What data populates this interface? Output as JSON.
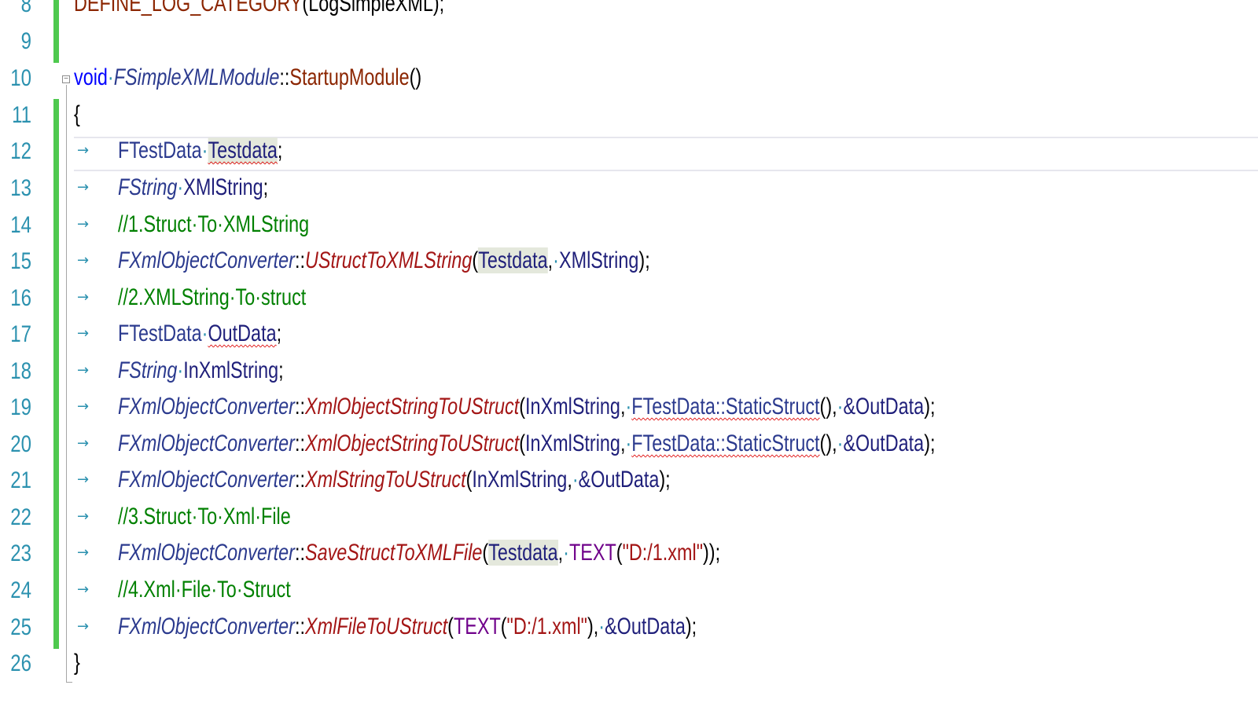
{
  "editor": {
    "lines": [
      {
        "num": "8",
        "tokens": [
          {
            "t": "DEFINE_LOG_CATEGORY",
            "c": "fn"
          },
          {
            "t": "(LogSimpleXML);",
            "c": "plain"
          }
        ]
      },
      {
        "num": "9",
        "tokens": []
      },
      {
        "num": "10",
        "tokens": [
          {
            "t": "void",
            "c": "kw"
          },
          {
            "t": "·",
            "c": "dot"
          },
          {
            "t": "FSimpleXMLModule",
            "c": "itype"
          },
          {
            "t": "::",
            "c": "plain"
          },
          {
            "t": "StartupModule",
            "c": "fn"
          },
          {
            "t": "()",
            "c": "plain"
          }
        ]
      },
      {
        "num": "11",
        "tokens": [
          {
            "t": "{",
            "c": "plain"
          }
        ]
      },
      {
        "num": "12",
        "tokens": [
          {
            "t": "FTestData",
            "c": "type"
          },
          {
            "t": "·",
            "c": "dot"
          },
          {
            "t": "Testdata",
            "c": "var hl squig"
          },
          {
            "t": ";",
            "c": "plain"
          }
        ]
      },
      {
        "num": "13",
        "tokens": [
          {
            "t": "FString",
            "c": "itype"
          },
          {
            "t": "·",
            "c": "dot"
          },
          {
            "t": "XMlString",
            "c": "var"
          },
          {
            "t": ";",
            "c": "plain"
          }
        ]
      },
      {
        "num": "14",
        "tokens": [
          {
            "t": "//1.Struct·To·XMLString",
            "c": "comment"
          }
        ]
      },
      {
        "num": "15",
        "tokens": [
          {
            "t": "FXmlObjectConverter",
            "c": "itype"
          },
          {
            "t": "::",
            "c": "plain"
          },
          {
            "t": "UStructToXMLString",
            "c": "ifn"
          },
          {
            "t": "(",
            "c": "plain"
          },
          {
            "t": "Testdata",
            "c": "var hl"
          },
          {
            "t": ",",
            "c": "plain"
          },
          {
            "t": "·",
            "c": "dot"
          },
          {
            "t": "XMlString",
            "c": "var"
          },
          {
            "t": ");",
            "c": "plain"
          }
        ]
      },
      {
        "num": "16",
        "tokens": [
          {
            "t": "//2.XMLString·To·struct",
            "c": "comment"
          }
        ]
      },
      {
        "num": "17",
        "tokens": [
          {
            "t": "FTestData",
            "c": "type"
          },
          {
            "t": "·",
            "c": "dot"
          },
          {
            "t": "OutData",
            "c": "var squig"
          },
          {
            "t": ";",
            "c": "plain"
          }
        ]
      },
      {
        "num": "18",
        "tokens": [
          {
            "t": "FString",
            "c": "itype"
          },
          {
            "t": "·",
            "c": "dot"
          },
          {
            "t": "InXmlString",
            "c": "var"
          },
          {
            "t": ";",
            "c": "plain"
          }
        ]
      },
      {
        "num": "19",
        "tokens": [
          {
            "t": "FXmlObjectConverter",
            "c": "itype"
          },
          {
            "t": "::",
            "c": "plain"
          },
          {
            "t": "XmlObjectStringToUStruct",
            "c": "ifn"
          },
          {
            "t": "(",
            "c": "plain"
          },
          {
            "t": "InXmlString",
            "c": "var"
          },
          {
            "t": ",",
            "c": "plain"
          },
          {
            "t": "·",
            "c": "dot"
          },
          {
            "t": "FTestData::StaticStruct",
            "c": "type squig"
          },
          {
            "t": "(),",
            "c": "plain"
          },
          {
            "t": "·",
            "c": "dot"
          },
          {
            "t": "&OutData",
            "c": "var"
          },
          {
            "t": ");",
            "c": "plain"
          }
        ]
      },
      {
        "num": "20",
        "tokens": [
          {
            "t": "FXmlObjectConverter",
            "c": "itype"
          },
          {
            "t": "::",
            "c": "plain"
          },
          {
            "t": "XmlObjectStringToUStruct",
            "c": "ifn"
          },
          {
            "t": "(",
            "c": "plain"
          },
          {
            "t": "InXmlString",
            "c": "var"
          },
          {
            "t": ",",
            "c": "plain"
          },
          {
            "t": "·",
            "c": "dot"
          },
          {
            "t": "FTestData::StaticStruct",
            "c": "type squig"
          },
          {
            "t": "(),",
            "c": "plain"
          },
          {
            "t": "·",
            "c": "dot"
          },
          {
            "t": "&OutData",
            "c": "var"
          },
          {
            "t": ");",
            "c": "plain"
          }
        ]
      },
      {
        "num": "21",
        "tokens": [
          {
            "t": "FXmlObjectConverter",
            "c": "itype"
          },
          {
            "t": "::",
            "c": "plain"
          },
          {
            "t": "XmlStringToUStruct",
            "c": "ifn"
          },
          {
            "t": "(",
            "c": "plain"
          },
          {
            "t": "InXmlString",
            "c": "var"
          },
          {
            "t": ",",
            "c": "plain"
          },
          {
            "t": "·",
            "c": "dot"
          },
          {
            "t": "&OutData",
            "c": "var"
          },
          {
            "t": ");",
            "c": "plain"
          }
        ]
      },
      {
        "num": "22",
        "tokens": [
          {
            "t": "//3.Struct·To·Xml·File",
            "c": "comment"
          }
        ]
      },
      {
        "num": "23",
        "tokens": [
          {
            "t": "FXmlObjectConverter",
            "c": "itype"
          },
          {
            "t": "::",
            "c": "plain"
          },
          {
            "t": "SaveStructToXMLFile",
            "c": "ifn"
          },
          {
            "t": "(",
            "c": "plain"
          },
          {
            "t": "Testdata",
            "c": "var hl"
          },
          {
            "t": ",",
            "c": "plain"
          },
          {
            "t": "·",
            "c": "dot"
          },
          {
            "t": "TEXT",
            "c": "macro"
          },
          {
            "t": "(",
            "c": "plain"
          },
          {
            "t": "\"D:/1.xml\"",
            "c": "str"
          },
          {
            "t": "));",
            "c": "plain"
          }
        ]
      },
      {
        "num": "24",
        "tokens": [
          {
            "t": "//4.Xml·File·To·Struct",
            "c": "comment"
          }
        ]
      },
      {
        "num": "25",
        "tokens": [
          {
            "t": "FXmlObjectConverter",
            "c": "itype"
          },
          {
            "t": "::",
            "c": "plain"
          },
          {
            "t": "XmlFileToUStruct",
            "c": "ifn"
          },
          {
            "t": "(",
            "c": "plain"
          },
          {
            "t": "TEXT",
            "c": "macro"
          },
          {
            "t": "(",
            "c": "plain"
          },
          {
            "t": "\"D:/1.xml\"",
            "c": "str"
          },
          {
            "t": "),",
            "c": "plain"
          },
          {
            "t": "·",
            "c": "dot"
          },
          {
            "t": "&OutData",
            "c": "var"
          },
          {
            "t": ");",
            "c": "plain"
          }
        ]
      },
      {
        "num": "26",
        "tokens": [
          {
            "t": "}",
            "c": "plain"
          }
        ]
      }
    ],
    "tab_glyph": "→",
    "fold_glyph": "−",
    "colors": {
      "line_number": "#2b91af",
      "change_bar": "#4ec94e",
      "keyword": "#0000ff",
      "comment": "#008000",
      "string": "#a31515",
      "highlight": "#e4e8dc"
    }
  }
}
